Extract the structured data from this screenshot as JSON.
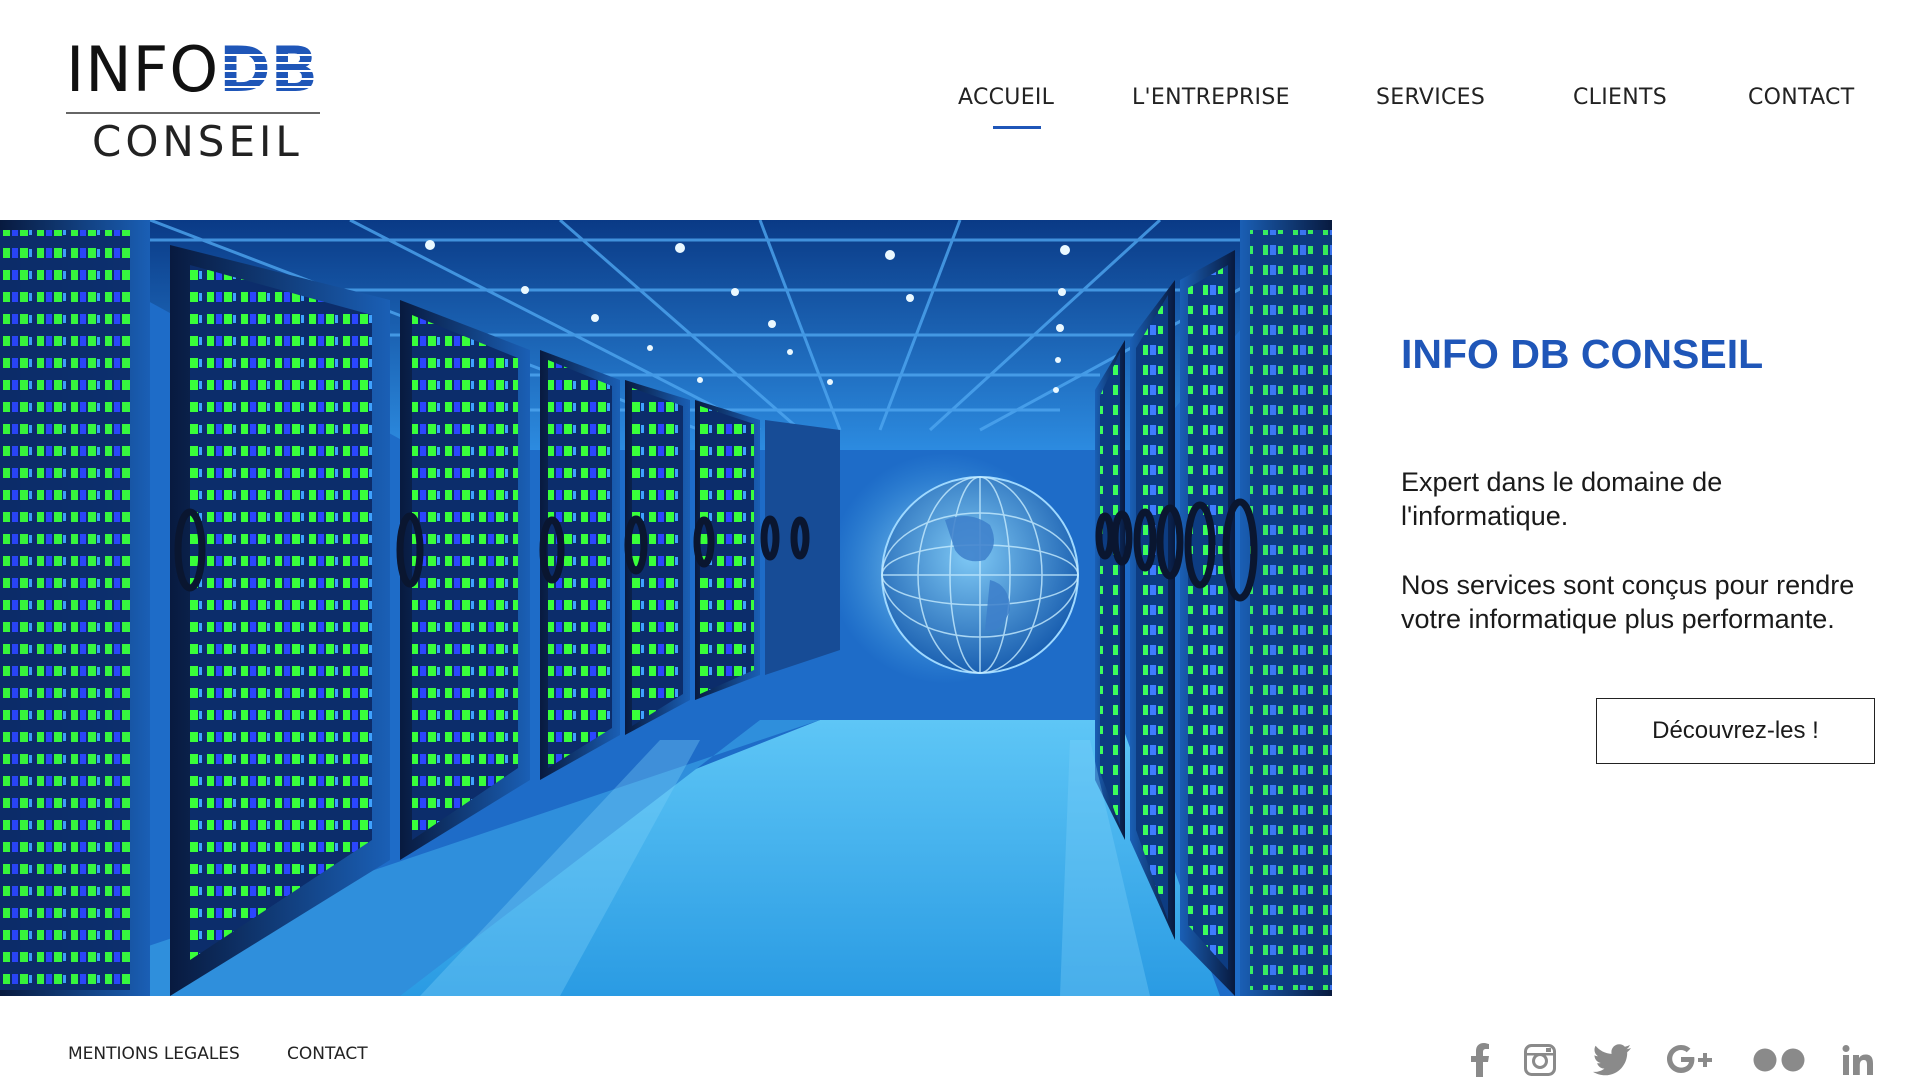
{
  "logo": {
    "top_left": "INFO",
    "top_right": "DB",
    "bottom": "CONSEIL"
  },
  "nav": {
    "items": [
      {
        "label": "ACCUEIL",
        "active": true
      },
      {
        "label": "L'ENTREPRISE",
        "active": false
      },
      {
        "label": "SERVICES",
        "active": false
      },
      {
        "label": "CLIENTS",
        "active": false
      },
      {
        "label": "CONTACT",
        "active": false
      }
    ]
  },
  "hero": {
    "image": "data-center-server-room-photo"
  },
  "content": {
    "headline": "INFO DB CONSEIL",
    "paragraph_1": "Expert dans le domaine de l'informatique.",
    "paragraph_2": "Nos services sont conçus pour rendre votre informatique plus performante.",
    "cta_label": "Découvrez-les !"
  },
  "footer": {
    "links": [
      {
        "label": "MENTIONS LEGALES"
      },
      {
        "label": "CONTACT"
      }
    ],
    "social": [
      "facebook-icon",
      "instagram-icon",
      "twitter-icon",
      "google-plus-icon",
      "flickr-icon",
      "linkedin-icon"
    ]
  },
  "colors": {
    "accent": "#1f56b8",
    "text": "#1a1a1a",
    "icon_gray": "#8a8a8a"
  }
}
